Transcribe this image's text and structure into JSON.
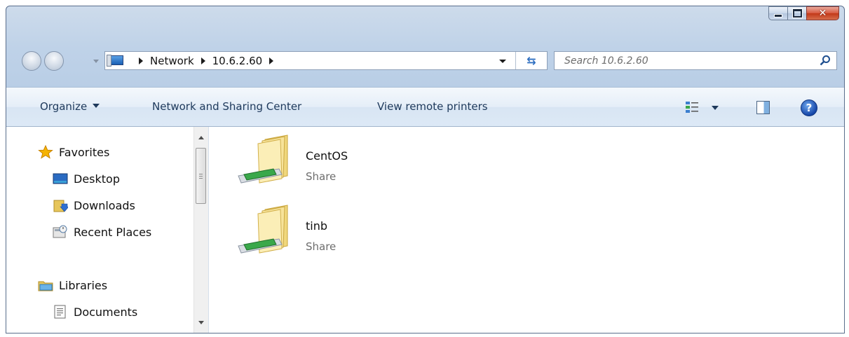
{
  "window": {
    "controls": {
      "minimize_icon": "minimize-icon",
      "maximize_icon": "maximize-icon",
      "close_icon": "close-icon",
      "close_color": "#c23818"
    }
  },
  "address_bar": {
    "crumbs": [
      "Network",
      "10.6.2.60"
    ]
  },
  "search": {
    "placeholder": "Search 10.6.2.60"
  },
  "command_bar": {
    "organize": "Organize",
    "network_sharing": "Network and Sharing Center",
    "view_printers": "View remote printers"
  },
  "nav_pane": {
    "items": [
      {
        "label": "Favorites",
        "icon": "star-icon"
      },
      {
        "label": "Desktop",
        "icon": "desktop-icon"
      },
      {
        "label": "Downloads",
        "icon": "downloads-icon"
      },
      {
        "label": "Recent Places",
        "icon": "recent-places-icon"
      },
      {
        "label": "Libraries",
        "icon": "libraries-icon"
      },
      {
        "label": "Documents",
        "icon": "documents-icon"
      }
    ]
  },
  "files": [
    {
      "name": "CentOS",
      "type": "Share",
      "icon": "network-share-folder-icon"
    },
    {
      "name": "tinb",
      "type": "Share",
      "icon": "network-share-folder-icon"
    }
  ],
  "colors": {
    "accent": "#1e395b",
    "window_bg": "#bfd2e8",
    "share_pipe": "#3aa84a"
  }
}
